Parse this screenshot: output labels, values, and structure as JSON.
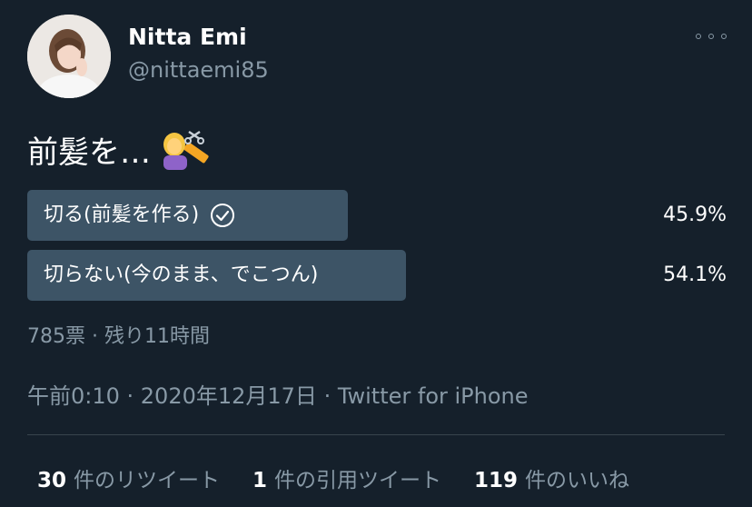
{
  "user": {
    "name": "Nitta Emi",
    "handle": "@nittaemi85",
    "avatar_icon": "profile-photo"
  },
  "tweet": {
    "text": "前髪を…",
    "emoji": "person-getting-haircut-icon"
  },
  "poll": {
    "options": [
      {
        "label": "切る(前髪を作る)",
        "percent": "45.9%",
        "fraction": 0.459,
        "selected": true
      },
      {
        "label": "切らない(今のまま、でこつん)",
        "percent": "54.1%",
        "fraction": 0.541,
        "selected": false
      }
    ],
    "meta": "785票 · 残り11時間",
    "bar_color": "#3d5466"
  },
  "timestamp": "午前0:10 · 2020年12月17日 · Twitter for iPhone",
  "stats": {
    "retweets_count": "30",
    "retweets_label": "件のリツイート",
    "quotes_count": "1",
    "quotes_label": "件の引用ツイート",
    "likes_count": "119",
    "likes_label": "件のいいね"
  },
  "colors": {
    "background": "#15202b",
    "secondary_text": "#8899a6",
    "divider": "#38444d"
  }
}
